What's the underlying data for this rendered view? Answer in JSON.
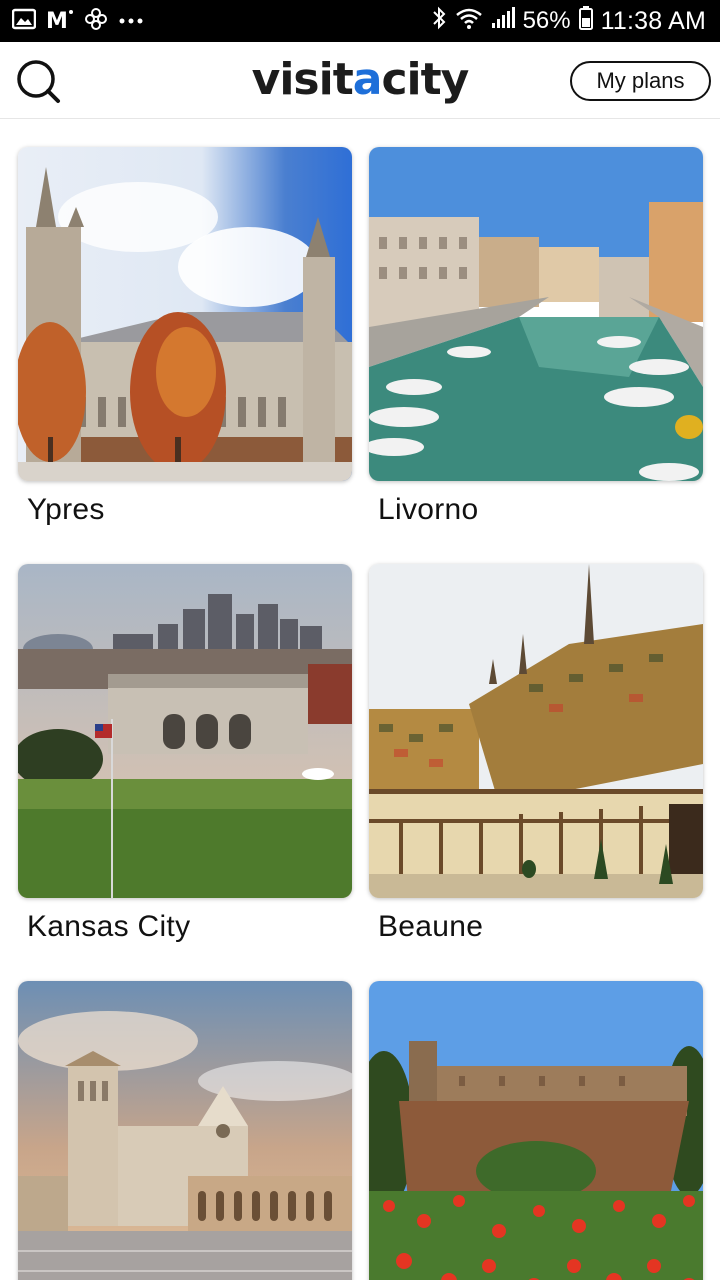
{
  "status_bar": {
    "battery": "56%",
    "time": "11:38 AM",
    "left_icons": [
      "image-icon",
      "gmail-icon",
      "pinwheel-icon",
      "more-dots-icon"
    ],
    "right_icons": [
      "bluetooth-icon",
      "wifi-icon",
      "signal-icon",
      "battery-icon"
    ]
  },
  "header": {
    "logo_part1": "visit",
    "logo_accent": "a",
    "logo_part2": "city",
    "plans_label": "My plans",
    "accent_color": "#1e6fd9"
  },
  "cities": [
    {
      "name": "Ypres"
    },
    {
      "name": "Livorno"
    },
    {
      "name": "Kansas City"
    },
    {
      "name": "Beaune"
    },
    {
      "name": ""
    },
    {
      "name": ""
    }
  ]
}
